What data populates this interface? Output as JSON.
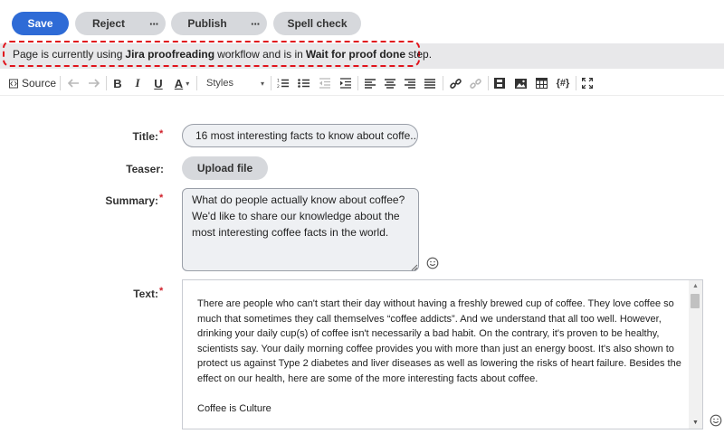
{
  "actions": {
    "save": "Save",
    "reject": "Reject",
    "publish": "Publish",
    "spellcheck": "Spell check",
    "more": "···"
  },
  "workflow": {
    "prefix": "Page is currently using",
    "workflow_name": "Jira proofreading",
    "middle": "workflow and is in",
    "step_name": "Wait for proof done",
    "suffix": "step."
  },
  "toolbar": {
    "source_label": "Source",
    "bold": "B",
    "italic": "I",
    "underline": "U",
    "font_color": "A",
    "styles_label": "Styles",
    "placeholder_label": "{#}"
  },
  "form": {
    "title_label": "Title:",
    "teaser_label": "Teaser:",
    "summary_label": "Summary:",
    "text_label": "Text:",
    "required_mark": "*",
    "title_value": "16 most interesting facts to know about coffe...",
    "upload_label": "Upload file",
    "summary_lines": [
      "What do people actually know about coffee?",
      "We'd like to share our knowledge about the",
      "most interesting coffee facts in the world."
    ],
    "text_lines": [
      "There are people who can't start their day without having a freshly brewed cup of coffee. They love coffee so",
      "much that sometimes they call themselves “coffee addicts”. And we understand that all too well. However,",
      "drinking your daily cup(s) of coffee isn't necessarily a bad habit. On the contrary, it's proven to be healthy,",
      "scientists say. Your daily morning coffee provides you with more than just an energy boost. It's also shown to",
      "protect us against Type 2 diabetes and liver diseases as well as lowering the risks of heart failure. Besides the",
      "effect on our health, here are some of the more interesting facts about coffee.",
      "",
      "Coffee is Culture"
    ]
  },
  "colors": {
    "primary": "#2e6bd6",
    "required": "#d0202a",
    "highlight_border": "#e0141c"
  }
}
